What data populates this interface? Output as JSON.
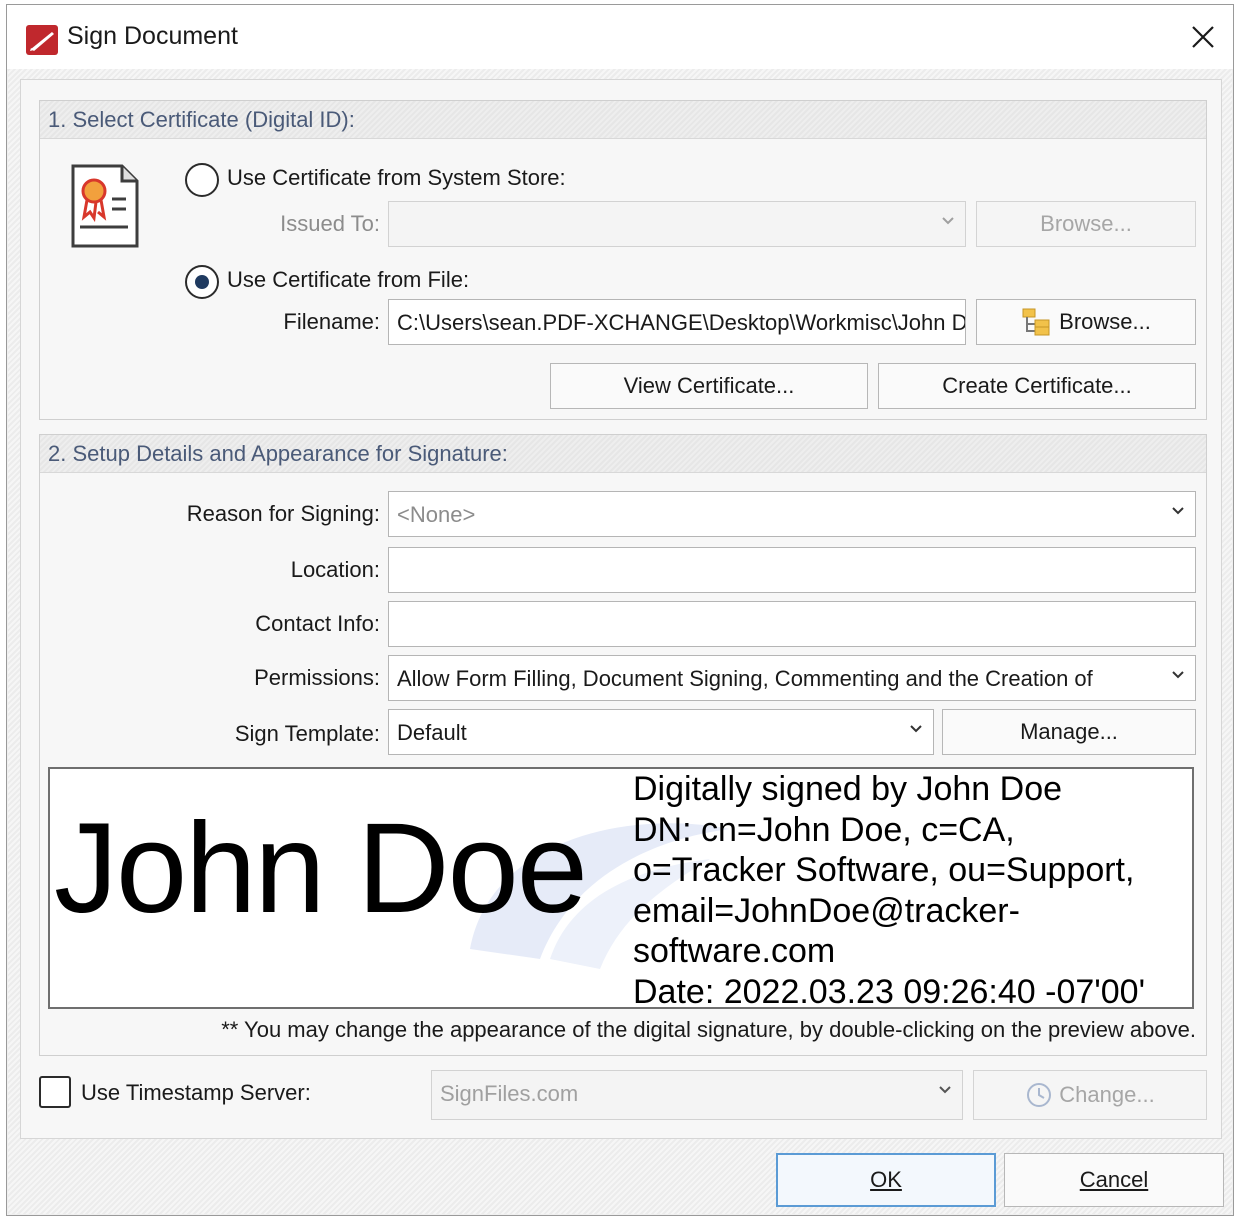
{
  "window": {
    "title": "Sign Document",
    "close_icon": "close-icon",
    "app_icon": "pdf-sign-app-icon"
  },
  "section1": {
    "header": "1. Select Certificate (Digital ID):",
    "certificate_icon": "certificate-icon",
    "system_store": {
      "label": "Use Certificate from System Store:",
      "selected": false,
      "issued_to_label": "Issued To:",
      "issued_to_value": "",
      "browse_label": "Browse..."
    },
    "from_file": {
      "label": "Use Certificate from File:",
      "selected": true,
      "filename_label": "Filename:",
      "filename_value": "C:\\Users\\sean.PDF-XCHANGE\\Desktop\\Workmisc\\John Doe.pfx",
      "browse_label": "Browse...",
      "browse_icon": "folder-tree-icon"
    },
    "view_certificate_label": "View Certificate...",
    "create_certificate_label": "Create Certificate..."
  },
  "section2": {
    "header": "2. Setup Details and Appearance for Signature:",
    "reason_label": "Reason for Signing:",
    "reason_value": "<None>",
    "location_label": "Location:",
    "location_value": "",
    "contact_label": "Contact Info:",
    "contact_value": "",
    "permissions_label": "Permissions:",
    "permissions_value": "Allow Form Filling, Document Signing, Commenting and the Creation of",
    "template_label": "Sign Template:",
    "template_value": "Default",
    "manage_label": "Manage...",
    "preview": {
      "name": "John Doe",
      "details": [
        "Digitally signed by John Doe",
        "DN: cn=John Doe, c=CA,",
        "o=Tracker Software, ou=Support,",
        "email=JohnDoe@tracker-",
        "software.com",
        "Date: 2022.03.23 09:26:40 -07'00'"
      ]
    },
    "note": "** You may change the appearance of the digital signature, by double-clicking on the preview above."
  },
  "timestamp": {
    "label": "Use Timestamp Server:",
    "checked": false,
    "server_value": "SignFiles.com",
    "change_label": "Change...",
    "change_icon": "clock-icon"
  },
  "footer": {
    "ok_label": "OK",
    "cancel_label": "Cancel"
  },
  "colors": {
    "header_text": "#4a5a78",
    "ok_border": "#5b9bd5",
    "app_icon": "#c0282d"
  }
}
